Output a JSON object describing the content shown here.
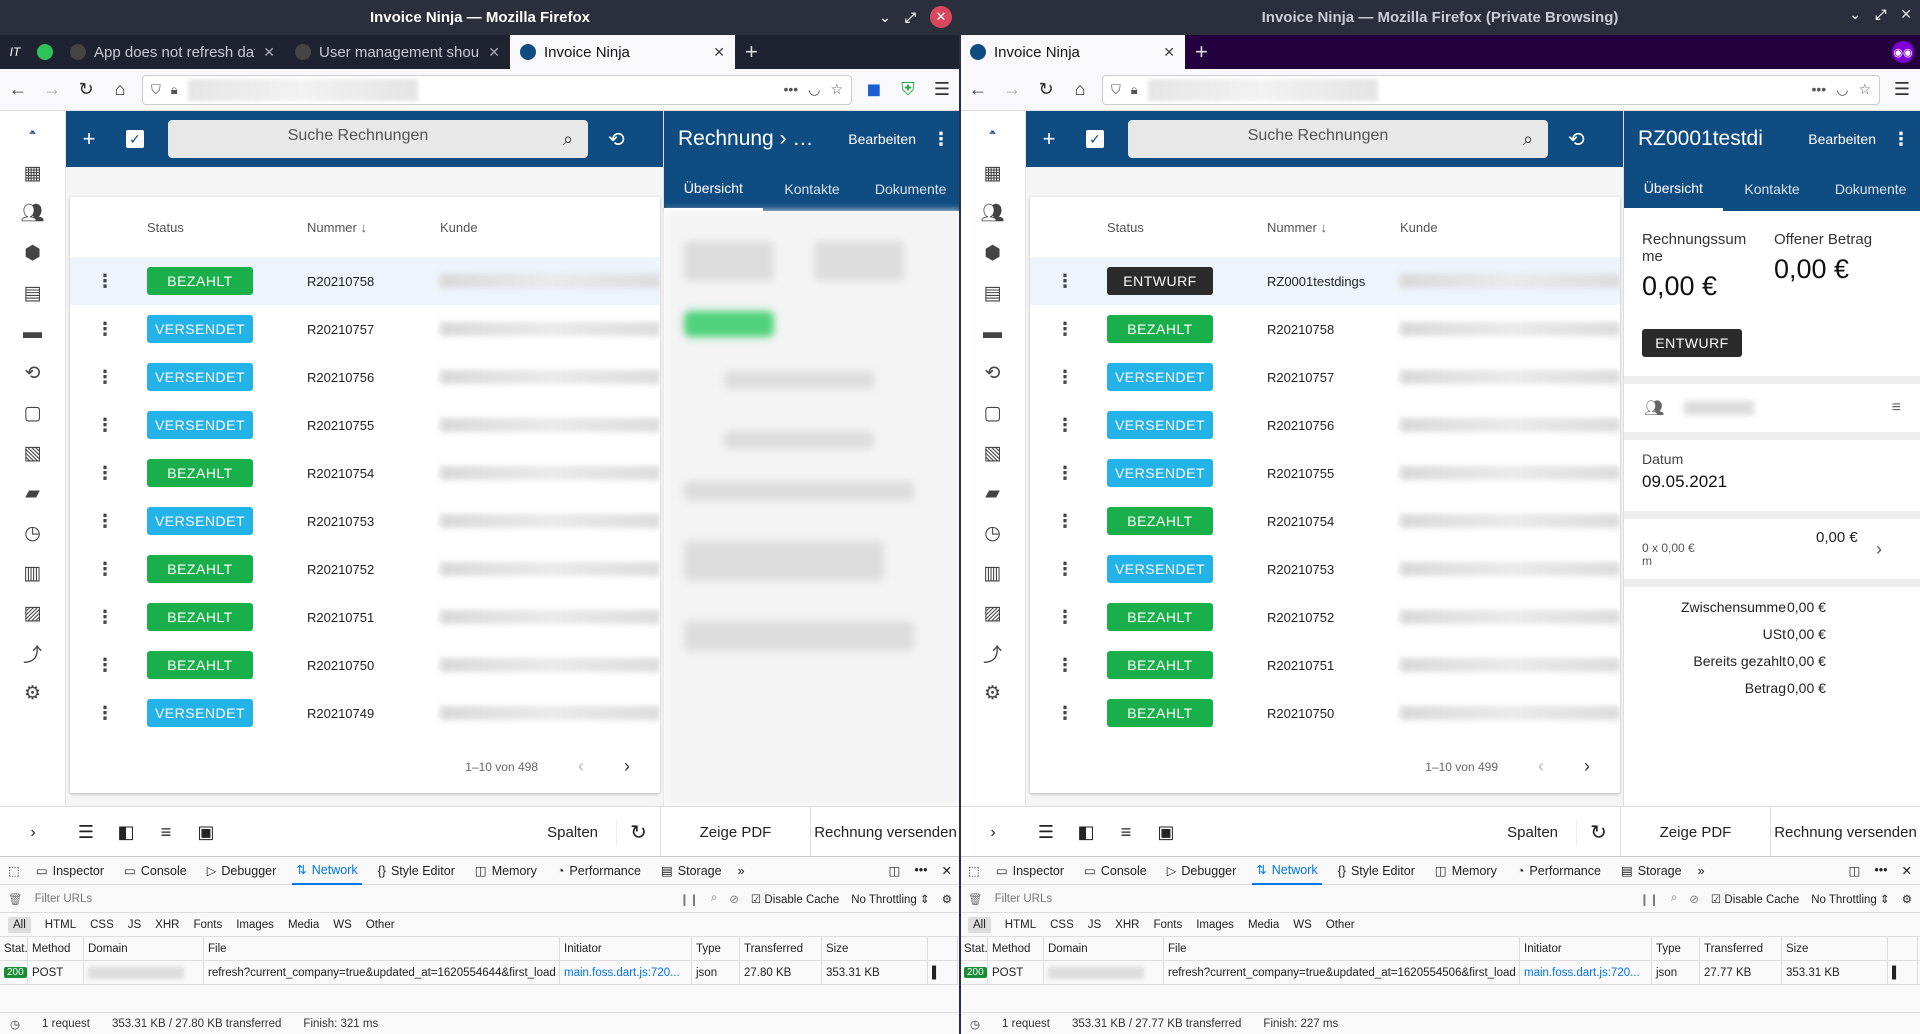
{
  "windows": [
    {
      "title": "Invoice Ninja — Mozilla Firefox",
      "pinned_label": "IT",
      "tabs": [
        {
          "label": "App does not refresh data",
          "active": false
        },
        {
          "label": "User management should",
          "active": false
        },
        {
          "label": "Invoice Ninja",
          "active": true
        }
      ],
      "search_placeholder": "Suche Rechnungen",
      "table": {
        "col_status": "Status",
        "col_number": "Nummer",
        "col_customer": "Kunde"
      },
      "rows": [
        {
          "status": "BEZAHLT",
          "kind": "paid",
          "number": "R20210758",
          "selected": true
        },
        {
          "status": "VERSENDET",
          "kind": "sent",
          "number": "R20210757"
        },
        {
          "status": "VERSENDET",
          "kind": "sent",
          "number": "R20210756"
        },
        {
          "status": "VERSENDET",
          "kind": "sent",
          "number": "R20210755"
        },
        {
          "status": "BEZAHLT",
          "kind": "paid",
          "number": "R20210754"
        },
        {
          "status": "VERSENDET",
          "kind": "sent",
          "number": "R20210753"
        },
        {
          "status": "BEZAHLT",
          "kind": "paid",
          "number": "R20210752"
        },
        {
          "status": "BEZAHLT",
          "kind": "paid",
          "number": "R20210751"
        },
        {
          "status": "BEZAHLT",
          "kind": "paid",
          "number": "R20210750"
        },
        {
          "status": "VERSENDET",
          "kind": "sent",
          "number": "R20210749"
        }
      ],
      "pager_text": "1–10 von 498",
      "detail": {
        "title": "Rechnung  ›  …",
        "edit": "Bearbeiten",
        "tabs": [
          "Übersicht",
          "Kontakte",
          "Dokumente"
        ]
      },
      "bottom": {
        "columns": "Spalten",
        "pdf": "Zeige PDF",
        "send": "Rechnung versenden"
      },
      "devtools": {
        "tabs": [
          "Inspector",
          "Console",
          "Debugger",
          "Network",
          "Style Editor",
          "Memory",
          "Performance",
          "Storage"
        ],
        "filter_placeholder": "Filter URLs",
        "disable_cache": "Disable Cache",
        "throttling": "No Throttling",
        "types": [
          "All",
          "HTML",
          "CSS",
          "JS",
          "XHR",
          "Fonts",
          "Images",
          "Media",
          "WS",
          "Other"
        ],
        "columns": [
          "Stat...",
          "Method",
          "Domain",
          "File",
          "Initiator",
          "Type",
          "Transferred",
          "Size",
          ""
        ],
        "request": {
          "status": "200",
          "method": "POST",
          "file": "refresh?current_company=true&updated_at=1620554644&first_load",
          "initiator": "main.foss.dart.js:720...",
          "type": "json",
          "transferred": "27.80 KB",
          "size": "353.31 KB"
        },
        "summary": {
          "requests": "1 request",
          "transferred": "353.31 KB / 27.80 KB transferred",
          "finish": "Finish: 321 ms"
        }
      }
    },
    {
      "title": "Invoice Ninja — Mozilla Firefox (Private Browsing)",
      "tabs": [
        {
          "label": "Invoice Ninja",
          "active": true
        }
      ],
      "search_placeholder": "Suche Rechnungen",
      "table": {
        "col_status": "Status",
        "col_number": "Nummer",
        "col_customer": "Kunde"
      },
      "rows": [
        {
          "status": "ENTWURF",
          "kind": "draft",
          "number": "RZ0001testdings",
          "selected": true
        },
        {
          "status": "BEZAHLT",
          "kind": "paid",
          "number": "R20210758"
        },
        {
          "status": "VERSENDET",
          "kind": "sent",
          "number": "R20210757"
        },
        {
          "status": "VERSENDET",
          "kind": "sent",
          "number": "R20210756"
        },
        {
          "status": "VERSENDET",
          "kind": "sent",
          "number": "R20210755"
        },
        {
          "status": "BEZAHLT",
          "kind": "paid",
          "number": "R20210754"
        },
        {
          "status": "VERSENDET",
          "kind": "sent",
          "number": "R20210753"
        },
        {
          "status": "BEZAHLT",
          "kind": "paid",
          "number": "R20210752"
        },
        {
          "status": "BEZAHLT",
          "kind": "paid",
          "number": "R20210751"
        },
        {
          "status": "BEZAHLT",
          "kind": "paid",
          "number": "R20210750"
        }
      ],
      "pager_text": "1–10 von 499",
      "detail": {
        "title": "RZ0001testdi",
        "edit": "Bearbeiten",
        "tabs": [
          "Übersicht",
          "Kontakte",
          "Dokumente"
        ],
        "total_label": "Rechnungssumme",
        "total_value": "0,00 €",
        "open_label": "Offener Betrag",
        "open_value": "0,00 €",
        "badge": "ENTWURF",
        "date_label": "Datum",
        "date_value": "09.05.2021",
        "line_qty": "0 x 0,00 €",
        "line_suffix": "m",
        "line_total": "0,00 €",
        "summary": [
          {
            "label": "Zwischensumme",
            "value": "0,00 €"
          },
          {
            "label": "USt",
            "value": "0,00 €"
          },
          {
            "label": "Bereits gezahlt",
            "value": "0,00 €"
          },
          {
            "label": "Betrag",
            "value": "0,00 €"
          }
        ]
      },
      "bottom": {
        "columns": "Spalten",
        "pdf": "Zeige PDF",
        "send": "Rechnung versenden"
      },
      "devtools": {
        "tabs": [
          "Inspector",
          "Console",
          "Debugger",
          "Network",
          "Style Editor",
          "Memory",
          "Performance",
          "Storage"
        ],
        "filter_placeholder": "Filter URLs",
        "disable_cache": "Disable Cache",
        "throttling": "No Throttling",
        "types": [
          "All",
          "HTML",
          "CSS",
          "JS",
          "XHR",
          "Fonts",
          "Images",
          "Media",
          "WS",
          "Other"
        ],
        "columns": [
          "Stat...",
          "Method",
          "Domain",
          "File",
          "Initiator",
          "Type",
          "Transferred",
          "Size",
          ""
        ],
        "request": {
          "status": "200",
          "method": "POST",
          "file": "refresh?current_company=true&updated_at=1620554506&first_load",
          "initiator": "main.foss.dart.js:720...",
          "type": "json",
          "transferred": "27.77 KB",
          "size": "353.31 KB"
        },
        "summary": {
          "requests": "1 request",
          "transferred": "353.31 KB / 27.77 KB transferred",
          "finish": "Finish: 227 ms"
        }
      }
    }
  ],
  "colors": {
    "brand": "#0f4c81",
    "paid": "#19b04b",
    "sent": "#23b3e8",
    "draft": "#2b2b2b"
  }
}
